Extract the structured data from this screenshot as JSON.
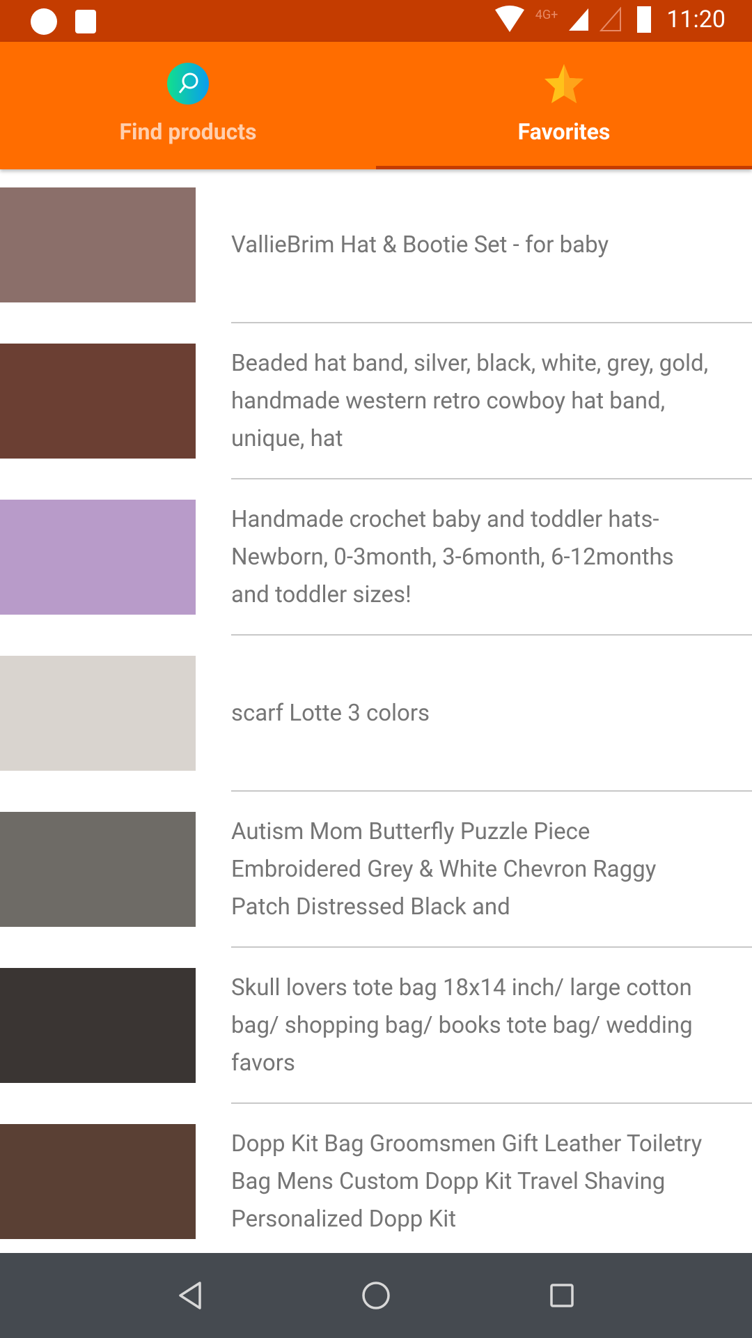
{
  "status_bar": {
    "time": "11:20",
    "network": "4G+",
    "icons": [
      "app-r-icon",
      "gallery-icon",
      "wifi-icon",
      "signal-icon",
      "signal-empty-icon",
      "battery-icon"
    ]
  },
  "tabs": [
    {
      "label": "Find products",
      "icon": "search-icon",
      "active": false
    },
    {
      "label": "Favorites",
      "icon": "star-icon",
      "active": true
    }
  ],
  "colors": {
    "accent": "#ff6d00",
    "status_bar": "#c43c00",
    "text": "#757575",
    "nav_bar": "#454a50"
  },
  "favorites": [
    {
      "title": "VallieBrim Hat & Bootie Set - for baby",
      "thumb_color": "#8b6f6a"
    },
    {
      "title": "Beaded hat band, silver, black, white, grey, gold, handmade western retro cowboy hat band, unique, hat",
      "thumb_color": "#6b3f33"
    },
    {
      "title": "Handmade crochet baby and toddler hats- Newborn, 0-3month, 3-6month, 6-12months and toddler sizes!",
      "thumb_color": "#b89bc9"
    },
    {
      "title": "scarf Lotte 3 colors",
      "thumb_color": "#d9d4cf"
    },
    {
      "title": "Autism Mom Butterfly Puzzle Piece Embroidered Grey & White Chevron Raggy Patch Distressed Black and",
      "thumb_color": "#6e6b66"
    },
    {
      "title": "Skull lovers tote bag 18x14 inch/ large cotton bag/ shopping bag/ books tote bag/ wedding favors",
      "thumb_color": "#3a3533"
    },
    {
      "title": "Dopp Kit Bag Groomsmen Gift Leather Toiletry Bag Mens Custom Dopp Kit Travel Shaving Personalized Dopp Kit",
      "thumb_color": "#5a4034"
    }
  ]
}
